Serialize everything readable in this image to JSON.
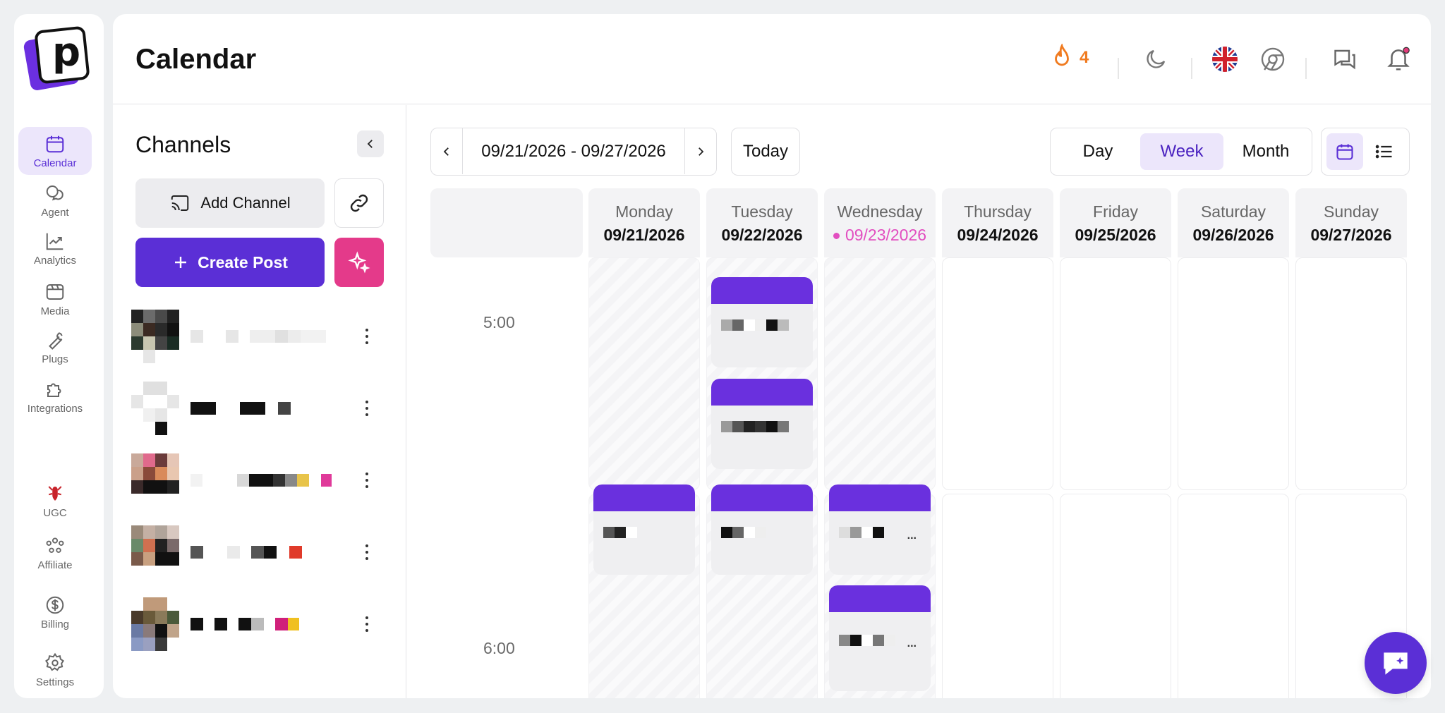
{
  "app": {
    "title": "Calendar"
  },
  "topbar": {
    "streak_count": "4"
  },
  "nav": {
    "items": [
      {
        "label": "Calendar",
        "icon": "calendar-icon",
        "active": true
      },
      {
        "label": "Agent",
        "icon": "chat-bubbles-icon",
        "active": false
      },
      {
        "label": "Analytics",
        "icon": "trend-chart-icon",
        "active": false
      },
      {
        "label": "Media",
        "icon": "media-icon",
        "active": false
      },
      {
        "label": "Plugs",
        "icon": "wrench-icon",
        "active": false
      },
      {
        "label": "Integrations",
        "icon": "puzzle-icon",
        "active": false
      },
      {
        "label": "UGC",
        "icon": "lobster-icon",
        "active": false
      },
      {
        "label": "Affiliate",
        "icon": "people-icon",
        "active": false
      },
      {
        "label": "Billing",
        "icon": "dollar-icon",
        "active": false
      },
      {
        "label": "Settings",
        "icon": "gear-icon",
        "active": false
      }
    ]
  },
  "channels": {
    "title": "Channels",
    "add_channel_label": "Add Channel",
    "create_post_label": "Create Post"
  },
  "calendar": {
    "date_range": "09/21/2026 - 09/27/2026",
    "today_label": "Today",
    "views": [
      "Day",
      "Week",
      "Month"
    ],
    "active_view": "Week",
    "days": [
      {
        "name": "Monday",
        "date": "09/21/2026"
      },
      {
        "name": "Tuesday",
        "date": "09/22/2026"
      },
      {
        "name": "Wednesday",
        "date": "09/23/2026"
      },
      {
        "name": "Thursday",
        "date": "09/24/2026"
      },
      {
        "name": "Friday",
        "date": "09/25/2026"
      },
      {
        "name": "Saturday",
        "date": "09/26/2026"
      },
      {
        "name": "Sunday",
        "date": "09/27/2026"
      }
    ],
    "today_date": "09/23/2026",
    "times": [
      "5:00",
      "6:00"
    ],
    "event_more": "..."
  },
  "colors": {
    "accent": "#5b2fd6",
    "event_bar": "#6a30de",
    "today": "#e24ec0",
    "streak": "#f07b20",
    "ai_button": "#e43a8a"
  }
}
